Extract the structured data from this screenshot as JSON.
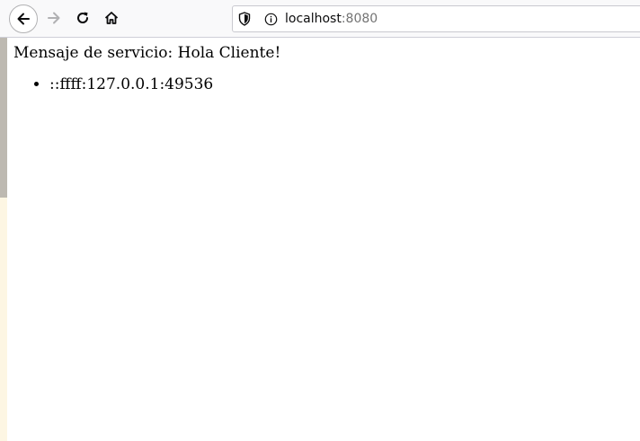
{
  "browser": {
    "url_host": "localhost",
    "url_port": ":8080",
    "icons": {
      "back": "back-arrow-icon",
      "forward": "forward-arrow-icon",
      "reload": "reload-icon",
      "home": "home-icon",
      "tracking": "shield-icon",
      "site_info": "info-icon"
    }
  },
  "page": {
    "service_message": "Mensaje de servicio: Hola Cliente!",
    "clients": [
      {
        "address": "::ffff:127.0.0.1:49536"
      }
    ]
  }
}
